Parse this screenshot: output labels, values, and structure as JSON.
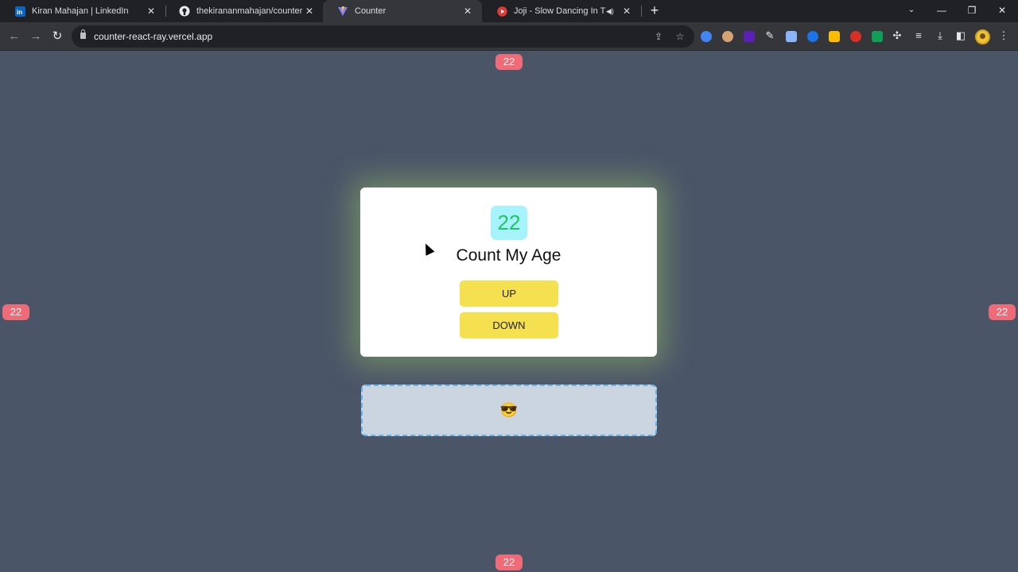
{
  "browser": {
    "tabs": [
      {
        "title": "Kiran Mahajan | LinkedIn",
        "favicon": "linkedin-icon"
      },
      {
        "title": "thekirananmahajan/counter",
        "favicon": "github-icon"
      },
      {
        "title": "Counter",
        "favicon": "vite-icon",
        "active": true
      },
      {
        "title": "Joji - Slow Dancing In The D",
        "favicon": "youtube-icon",
        "audio": true
      }
    ],
    "url": "counter-react-ray.vercel.app"
  },
  "page": {
    "count": "22",
    "heading": "Count My Age",
    "up_label": "UP",
    "down_label": "DOWN",
    "emoji": "😎",
    "badges": {
      "top": "22",
      "left": "22",
      "right": "22",
      "bottom": "22"
    }
  },
  "colors": {
    "page_bg": "#4a5568",
    "badge": "#ef6b77",
    "count_bg": "#a5f3fc",
    "count_text": "#22c55e",
    "button": "#f5e050",
    "glow": "#bef264"
  }
}
